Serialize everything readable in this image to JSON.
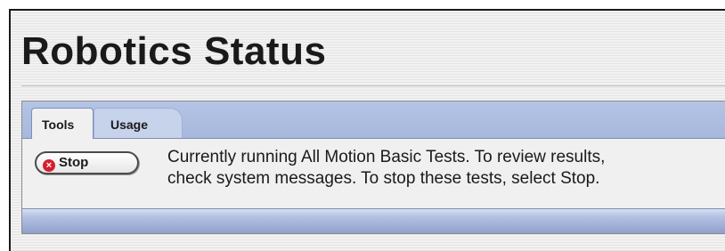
{
  "page": {
    "title": "Robotics Status"
  },
  "tabs": [
    {
      "label": "Tools",
      "active": true
    },
    {
      "label": "Usage",
      "active": false
    }
  ],
  "tools": {
    "stop_label": "Stop",
    "stop_icon": "stop-circle-icon",
    "message_line1": "Currently running All Motion Basic Tests. To review results,",
    "message_line2": "check system messages. To stop these tests, select Stop."
  },
  "colors": {
    "tab_bar": "#a7b8dc",
    "stop_icon": "#d4202c"
  }
}
